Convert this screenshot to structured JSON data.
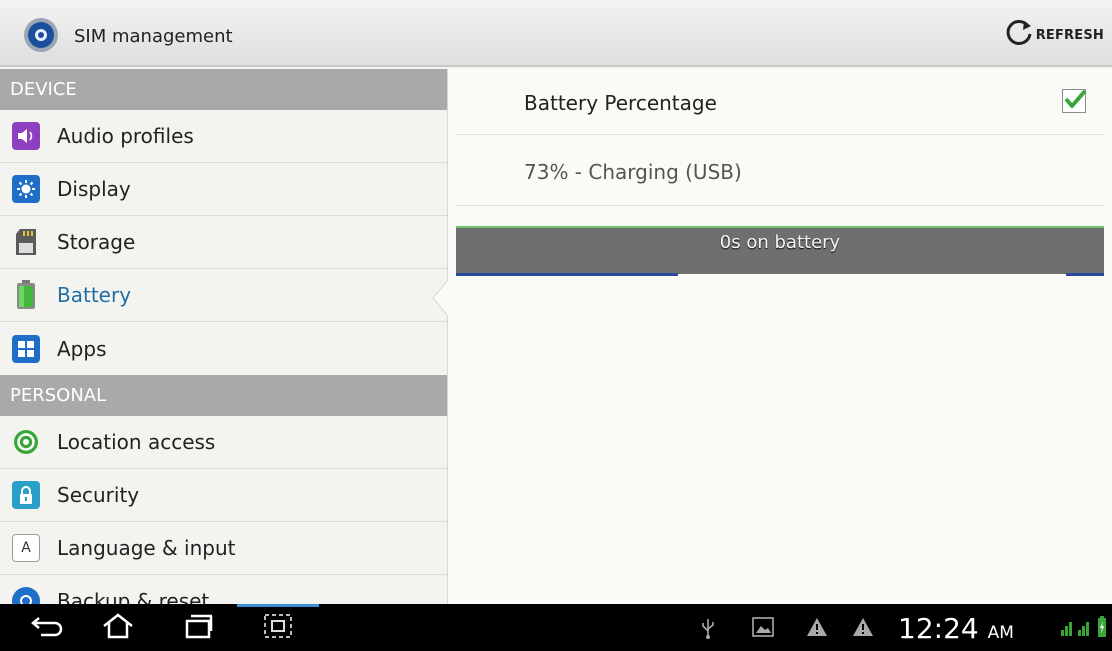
{
  "action_bar": {
    "title": "SIM management",
    "refresh_label": "REFRESH",
    "app_icon": "settings-gear-icon"
  },
  "sidebar": {
    "sections": [
      {
        "header": "DEVICE",
        "items": [
          {
            "label": "Audio profiles",
            "icon": "audio-profiles-icon"
          },
          {
            "label": "Display",
            "icon": "display-brightness-icon"
          },
          {
            "label": "Storage",
            "icon": "sd-card-icon"
          },
          {
            "label": "Battery",
            "icon": "battery-icon",
            "selected": true
          },
          {
            "label": "Apps",
            "icon": "apps-grid-icon"
          }
        ]
      },
      {
        "header": "PERSONAL",
        "items": [
          {
            "label": "Location access",
            "icon": "location-target-icon"
          },
          {
            "label": "Security",
            "icon": "lock-icon"
          },
          {
            "label": "Language & input",
            "icon": "keyboard-a-icon"
          },
          {
            "label": "Backup & reset",
            "icon": "backup-icon"
          }
        ]
      }
    ]
  },
  "battery_page": {
    "percentage_pref_label": "Battery Percentage",
    "percentage_pref_checked": true,
    "status": "73% - Charging (USB)",
    "graph_label": "0s on battery"
  },
  "system_bar": {
    "time": "12:24",
    "ampm": "AM",
    "icons": [
      "back-icon",
      "home-icon",
      "recent-apps-icon",
      "screenshot-icon",
      "usb-icon",
      "gallery-icon",
      "warning-icon",
      "warning-icon",
      "signal-icon",
      "battery-charging-icon"
    ]
  },
  "colors": {
    "accent": "#1f6fa8",
    "section_header": "#a9a9a9",
    "graph_bg": "#6f6f6f",
    "check_green": "#3aa63a"
  }
}
